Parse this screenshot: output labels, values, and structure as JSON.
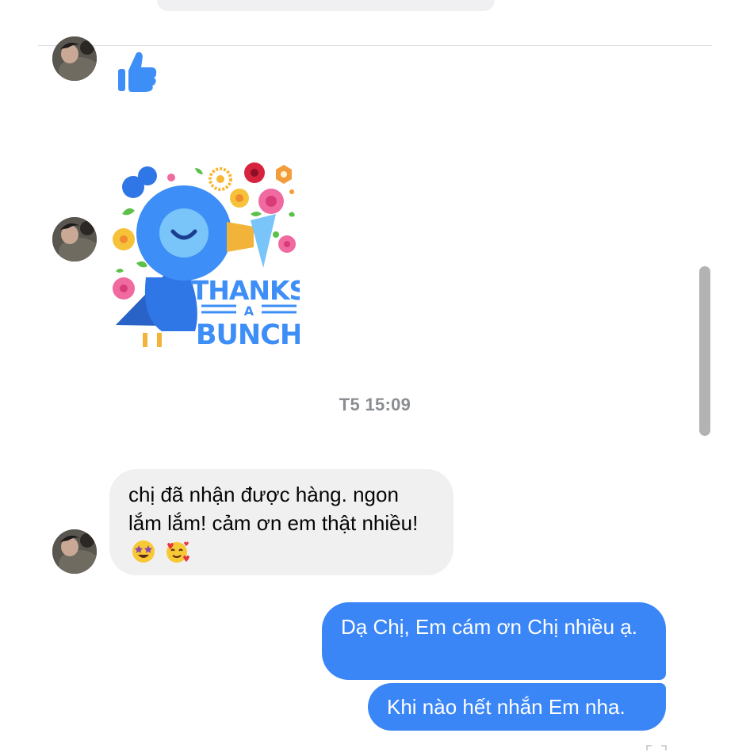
{
  "conversation": {
    "timestamp": "T5 15:09",
    "messages_in": {
      "text": "chị đã nhận được hàng. ngon lắm lắm! cảm ơn em thật nhiều!",
      "emoji_1": "star-struck-emoji",
      "emoji_2": "smiling-face-with-hearts-emoji"
    },
    "messages_out": [
      {
        "text": "Dạ Chị, Em cám ơn Chị nhiều ạ."
      },
      {
        "text": "Khi nào hết nhắn Em nha."
      }
    ],
    "sticker": {
      "name": "thanks-a-bunch-sticker",
      "line1": "THANKS",
      "line2": "A",
      "line3": "BUNCH"
    },
    "like": {
      "icon": "thumbs-up-icon"
    }
  },
  "colors": {
    "outgoing_bubble": "#3b86f7",
    "incoming_bubble": "#f0f0f0",
    "timestamp": "#8a8d91",
    "like_blue": "#3e8ef7"
  }
}
